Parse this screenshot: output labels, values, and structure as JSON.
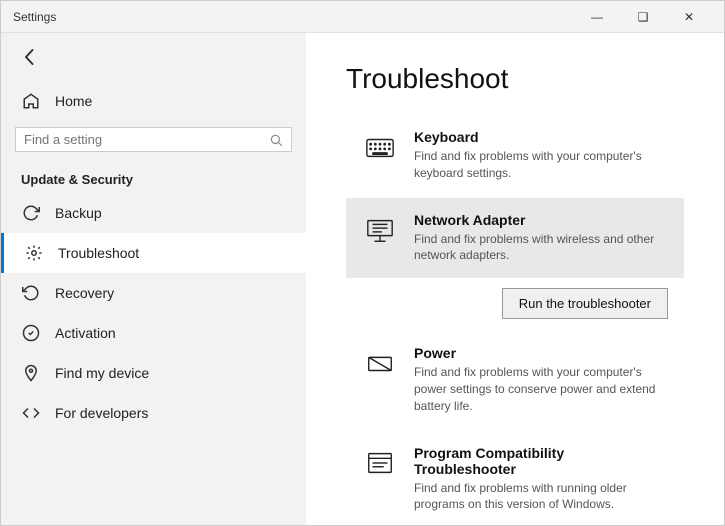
{
  "titlebar": {
    "title": "Settings",
    "minimize": "—",
    "maximize": "❑",
    "close": "✕"
  },
  "sidebar": {
    "back_icon": "←",
    "home_label": "Home",
    "search_placeholder": "Find a setting",
    "section_title": "Update & Security",
    "items": [
      {
        "id": "backup",
        "label": "Backup",
        "icon": "backup"
      },
      {
        "id": "troubleshoot",
        "label": "Troubleshoot",
        "icon": "troubleshoot",
        "active": true
      },
      {
        "id": "recovery",
        "label": "Recovery",
        "icon": "recovery"
      },
      {
        "id": "activation",
        "label": "Activation",
        "icon": "activation"
      },
      {
        "id": "find-my-device",
        "label": "Find my device",
        "icon": "find-device"
      },
      {
        "id": "for-developers",
        "label": "For developers",
        "icon": "developers"
      }
    ]
  },
  "main": {
    "title": "Troubleshoot",
    "items": [
      {
        "id": "keyboard",
        "name": "Keyboard",
        "desc": "Find and fix problems with your computer's keyboard settings.",
        "highlighted": false,
        "icon": "keyboard"
      },
      {
        "id": "network-adapter",
        "name": "Network Adapter",
        "desc": "Find and fix problems with wireless and other network adapters.",
        "highlighted": true,
        "icon": "network"
      },
      {
        "id": "power",
        "name": "Power",
        "desc": "Find and fix problems with your computer's power settings to conserve power and extend battery life.",
        "highlighted": false,
        "icon": "power"
      },
      {
        "id": "program-compatibility",
        "name": "Program Compatibility Troubleshooter",
        "desc": "Find and fix problems with running older programs on this version of Windows.",
        "highlighted": false,
        "icon": "compat"
      }
    ],
    "run_btn_label": "Run the troubleshooter"
  }
}
